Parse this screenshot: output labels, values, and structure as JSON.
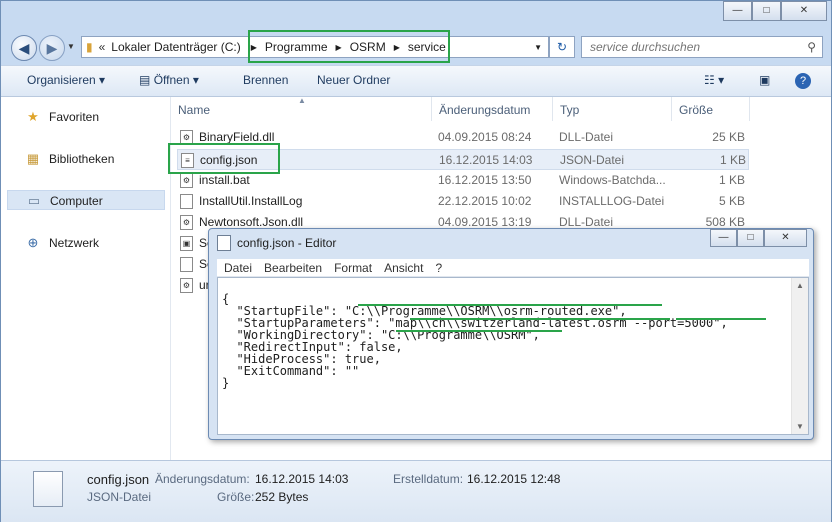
{
  "window": {
    "min": "—",
    "max": "□",
    "close": "✕"
  },
  "address": {
    "prefix": "«",
    "crumbs": [
      "Lokaler Datenträger (C:)",
      "Programme",
      "OSRM",
      "service"
    ],
    "search_placeholder": "service durchsuchen"
  },
  "toolbar": {
    "organize": "Organisieren",
    "open": "Öffnen",
    "burn": "Brennen",
    "new_folder": "Neuer Ordner"
  },
  "nav": [
    "Favoriten",
    "Bibliotheken",
    "Computer",
    "Netzwerk"
  ],
  "columns": {
    "name": "Name",
    "date": "Änderungsdatum",
    "type": "Typ",
    "size": "Größe"
  },
  "files": [
    {
      "name": "BinaryField.dll",
      "date": "04.09.2015 08:24",
      "type": "DLL-Datei",
      "size": "25 KB",
      "icon": "dll-icon"
    },
    {
      "name": "config.json",
      "date": "16.12.2015 14:03",
      "type": "JSON-Datei",
      "size": "1 KB",
      "icon": "json-icon"
    },
    {
      "name": "install.bat",
      "date": "16.12.2015 13:50",
      "type": "Windows-Batchda...",
      "size": "1 KB",
      "icon": "bat-icon"
    },
    {
      "name": "InstallUtil.InstallLog",
      "date": "22.12.2015 10:02",
      "type": "INSTALLLOG-Datei",
      "size": "5 KB",
      "icon": "file-icon"
    },
    {
      "name": "Newtonsoft.Json.dll",
      "date": "04.09.2015 13:19",
      "type": "DLL-Datei",
      "size": "508 KB",
      "icon": "dll-icon"
    },
    {
      "name": "Se",
      "icon": "exe-icon"
    },
    {
      "name": "Se",
      "icon": "file-icon"
    },
    {
      "name": "ur",
      "icon": "bat-icon"
    }
  ],
  "details": {
    "name": "config.json",
    "type": "JSON-Datei",
    "modified_label": "Änderungsdatum:",
    "modified": "16.12.2015 14:03",
    "created_label": "Erstelldatum:",
    "created": "16.12.2015 12:48",
    "size_label": "Größe:",
    "size": "252 Bytes"
  },
  "editor": {
    "title": "config.json - Editor",
    "menu": [
      "Datei",
      "Bearbeiten",
      "Format",
      "Ansicht",
      "?"
    ],
    "lines": [
      "{",
      "  \"StartupFile\": \"C:\\\\Programme\\\\OSRM\\\\osrm-routed.exe\",",
      "  \"StartupParameters\": \"map\\\\ch\\\\switzerland-latest.osrm --port=5000\",",
      "  \"WorkingDirectory\": \"C:\\\\Programme\\\\OSRM\",",
      "  \"RedirectInput\": false,",
      "  \"HideProcess\": true,",
      "  \"ExitCommand\": \"\"",
      "}"
    ]
  },
  "colors": {
    "highlight": "#2aa44a",
    "selection": "#e7eef8"
  }
}
